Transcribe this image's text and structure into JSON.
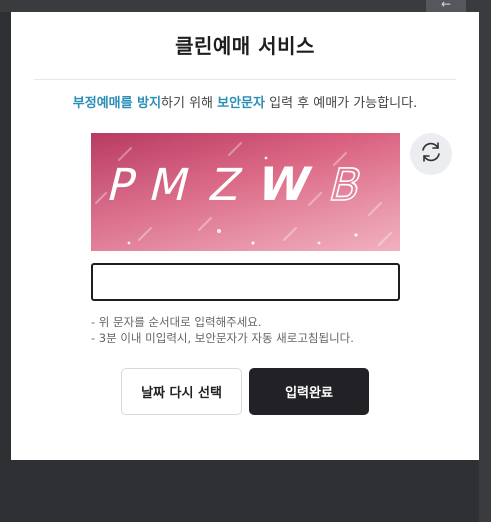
{
  "window": {
    "back_icon": "arrow-left-icon"
  },
  "modal": {
    "title": "클린예매 서비스",
    "notice": {
      "highlight1": "부정예매를 방지",
      "text1": "하기 위해 ",
      "highlight2": "보안문자",
      "text2": " 입력 후 예매가 가능합니다."
    },
    "captcha": {
      "text": "PMZWB",
      "refresh_icon": "refresh-icon"
    },
    "input": {
      "value": "",
      "placeholder": ""
    },
    "guide": [
      "- 위 문자를 순서대로 입력해주세요.",
      "- 3분 이내 미입력시, 보안문자가 자동 새로고침됩니다."
    ],
    "buttons": {
      "reselect_label": "날짜 다시 선택",
      "submit_label": "입력완료"
    }
  },
  "colors": {
    "highlight": "#2a8fb8",
    "submit_bg": "#222226",
    "captcha_gradient": [
      "#c9456a",
      "#e58aa0"
    ]
  }
}
